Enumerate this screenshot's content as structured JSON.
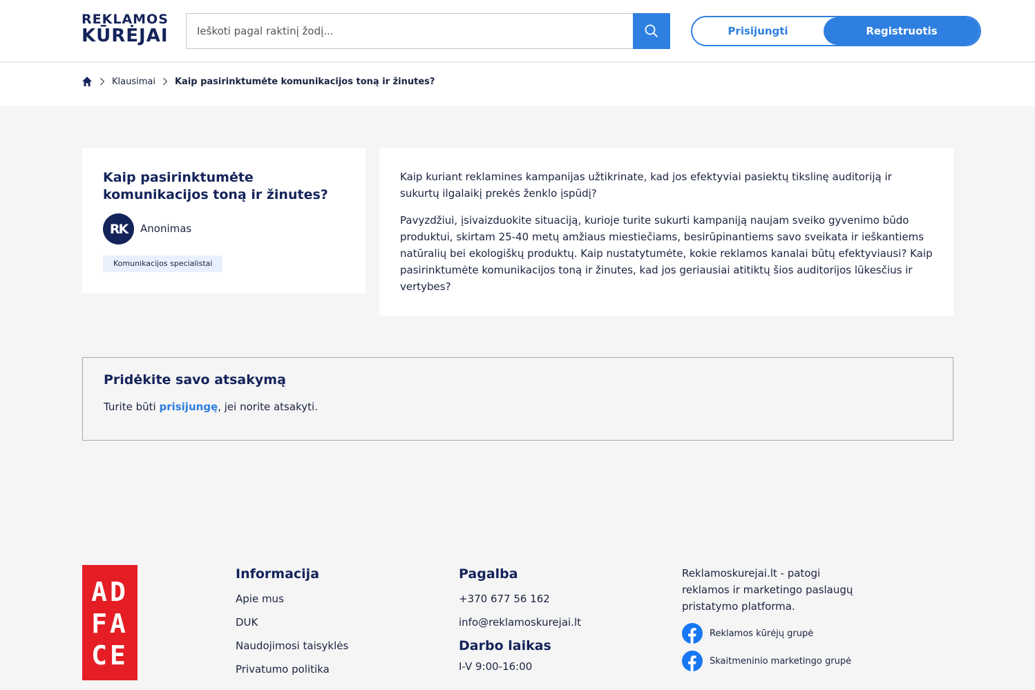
{
  "header": {
    "logo_line1": "REKLAMOS",
    "logo_line2": "KŪRĖJAI",
    "search_placeholder": "Ieškoti pagal raktinį žodį...",
    "login_label": "Prisijungti",
    "register_label": "Registruotis"
  },
  "breadcrumb": {
    "section": "Klausimai",
    "current": "Kaip pasirinktumėte komunikacijos toną ir žinutes?"
  },
  "question": {
    "title": "Kaip pasirinktumėte komunikacijos toną ir žinutes?",
    "avatar_initials": "RK",
    "author": "Anonimas",
    "tag": "Komunikacijos specialistai",
    "paragraph1": "Kaip kuriant reklamines kampanijas užtikrinate, kad jos efektyviai pasiektų tikslinę auditoriją ir sukurtų ilgalaikį prekės ženklo įspūdį?",
    "paragraph2": "Pavyzdžiui, įsivaizduokite situaciją, kurioje turite sukurti kampaniją naujam sveiko gyvenimo būdo produktui, skirtam 25-40 metų amžiaus miestiečiams, besirūpinantiems savo sveikata ir ieškantiems natūralių bei ekologiškų produktų. Kaip nustatytumėte, kokie reklamos kanalai būtų efektyviausi? Kaip pasirinktumėte komunikacijos toną ir žinutes, kad jos geriausiai atitiktų šios auditorijos lūkesčius ir vertybes?"
  },
  "answer_box": {
    "heading": "Pridėkite savo atsakymą",
    "text_before": "Turite būti ",
    "link": "prisijungę",
    "text_after": ", jei norite atsakyti."
  },
  "footer": {
    "adface_lines": [
      "AD",
      "FA",
      "CE"
    ],
    "info": {
      "heading": "Informacija",
      "links": [
        "Apie mus",
        "DUK",
        "Naudojimosi taisyklės",
        "Privatumo politika"
      ]
    },
    "help": {
      "heading": "Pagalba",
      "phone": "+370 677 56 162",
      "email": "info@reklamoskurejai.lt",
      "hours_heading": "Darbo laikas",
      "hours": "I-V 9:00-16:00"
    },
    "about": {
      "text": "Reklamoskurejai.lt - patogi reklamos ir marketingo paslaugų pristatymo platforma.",
      "fb_group1": "Reklamos kūrėjų grupė",
      "fb_group2": "Skaitmeninio marketingo grupė"
    }
  },
  "colors": {
    "primary": "#2e7fe0",
    "navy": "#14235a",
    "adface_red": "#e51e25"
  }
}
